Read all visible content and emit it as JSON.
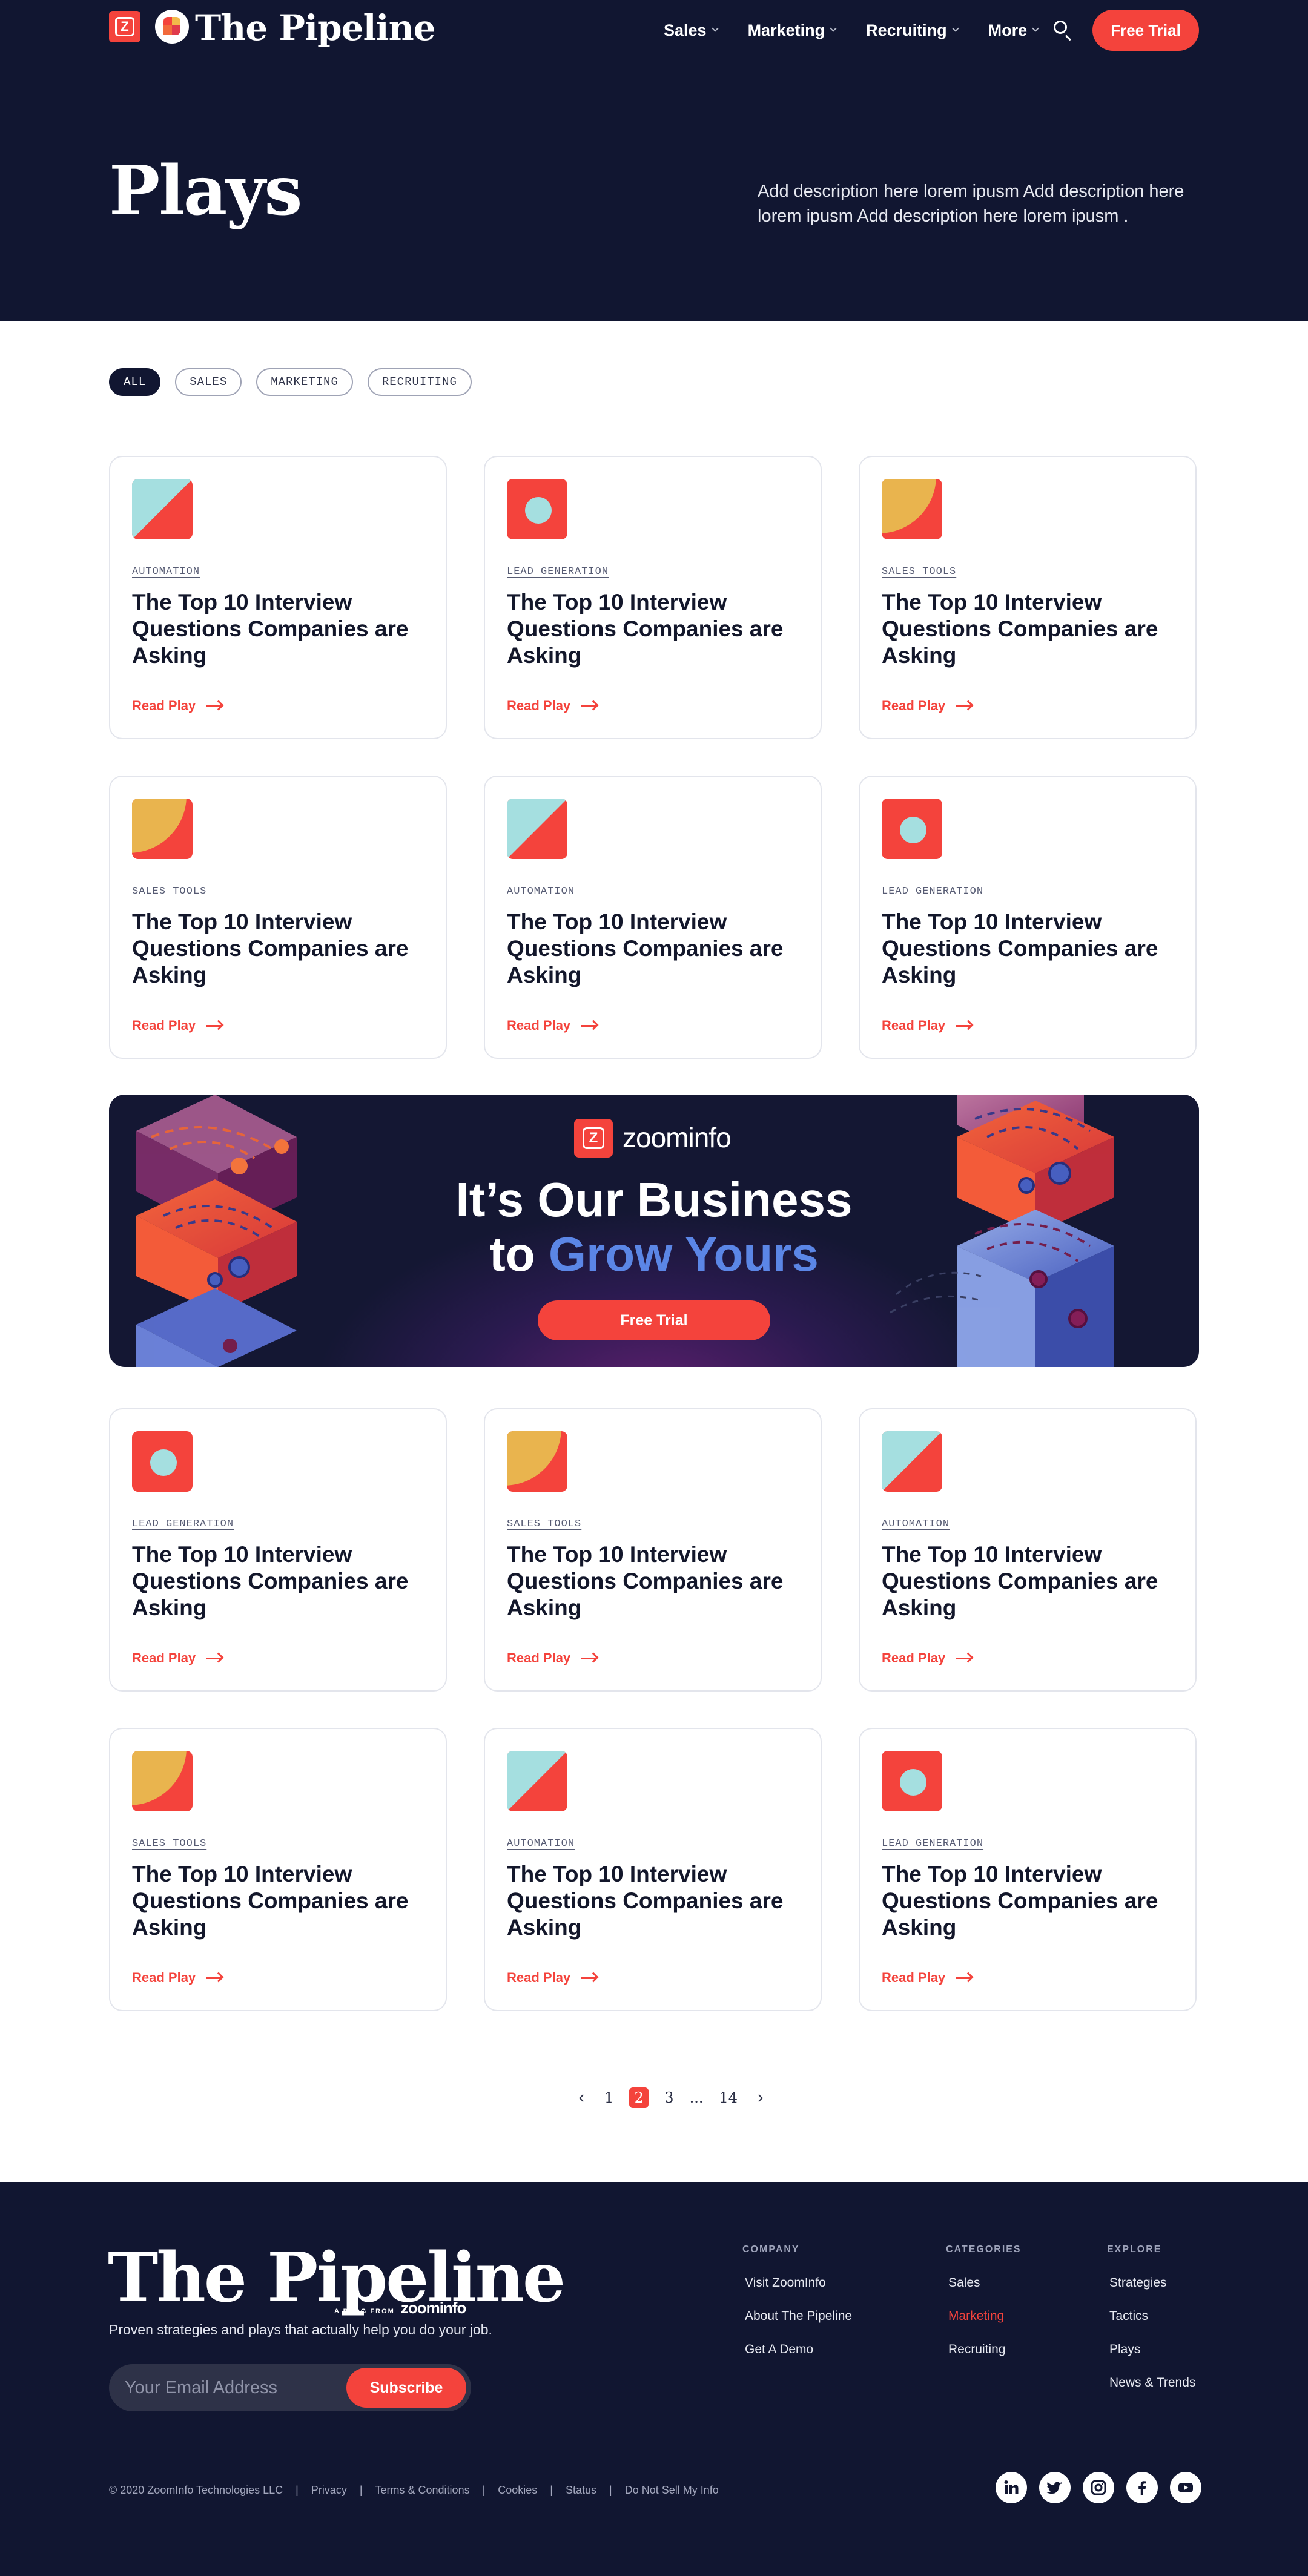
{
  "nav": {
    "brand": "The Pipeline",
    "items": [
      {
        "label": "Sales"
      },
      {
        "label": "Marketing"
      },
      {
        "label": "Recruiting"
      },
      {
        "label": "More"
      }
    ],
    "cta": "Free Trial"
  },
  "hero": {
    "title": "Plays",
    "description": "Add description here lorem ipusm  Add description here lorem ipusm Add description here lorem ipusm ."
  },
  "filters": [
    {
      "label": "ALL",
      "active": true
    },
    {
      "label": "SALES",
      "active": false
    },
    {
      "label": "MARKETING",
      "active": false
    },
    {
      "label": "RECRUITING",
      "active": false
    }
  ],
  "cards": [
    {
      "tag": "AUTOMATION",
      "title": "The Top 10 Interview Questions Companies are Asking",
      "link": "Read Play",
      "thumb": "diagonal"
    },
    {
      "tag": "LEAD GENERATION",
      "title": "The Top 10 Interview Questions Companies are Asking",
      "link": "Read Play",
      "thumb": "circle"
    },
    {
      "tag": "SALES TOOLS",
      "title": "The Top 10 Interview Questions Companies are Asking",
      "link": "Read Play",
      "thumb": "quarter"
    },
    {
      "tag": "SALES TOOLS",
      "title": "The Top 10 Interview Questions Companies are Asking",
      "link": "Read Play",
      "thumb": "quarter"
    },
    {
      "tag": "AUTOMATION",
      "title": "The Top 10 Interview Questions Companies are Asking",
      "link": "Read Play",
      "thumb": "diagonal"
    },
    {
      "tag": "LEAD GENERATION",
      "title": "The Top 10 Interview Questions Companies are Asking",
      "link": "Read Play",
      "thumb": "circle"
    },
    {
      "tag": "LEAD GENERATION",
      "title": "The Top 10 Interview Questions Companies are Asking",
      "link": "Read Play",
      "thumb": "circle"
    },
    {
      "tag": "SALES TOOLS",
      "title": "The Top 10 Interview Questions Companies are Asking",
      "link": "Read Play",
      "thumb": "quarter"
    },
    {
      "tag": "AUTOMATION",
      "title": "The Top 10 Interview Questions Companies are Asking",
      "link": "Read Play",
      "thumb": "diagonal"
    },
    {
      "tag": "SALES TOOLS",
      "title": "The Top 10 Interview Questions Companies are Asking",
      "link": "Read Play",
      "thumb": "quarter"
    },
    {
      "tag": "AUTOMATION",
      "title": "The Top 10 Interview Questions Companies are Asking",
      "link": "Read Play",
      "thumb": "diagonal"
    },
    {
      "tag": "LEAD GENERATION",
      "title": "The Top 10 Interview Questions Companies are Asking",
      "link": "Read Play",
      "thumb": "circle"
    }
  ],
  "banner": {
    "logo_word": "zoominfo",
    "line1": "It’s Our Business",
    "line2_prefix": "to ",
    "line2_highlight": "Grow Yours",
    "cta": "Free Trial"
  },
  "pagination": {
    "pages": [
      "1",
      "2",
      "3",
      "...",
      "14"
    ],
    "current": "2"
  },
  "footer": {
    "brand": "The Pipeline",
    "sub_small": "A BLOG FROM",
    "sub_brand": "zoominfo",
    "tagline": "Proven strategies and plays that actually help you do your job.",
    "email_placeholder": "Your Email Address",
    "subscribe": "Subscribe",
    "columns": [
      {
        "heading": "COMPANY",
        "links": [
          "Visit ZoomInfo",
          "About The Pipeline",
          "Get A Demo"
        ]
      },
      {
        "heading": "CATEGORIES",
        "links": [
          "Sales",
          "Marketing",
          "Recruiting"
        ],
        "active": "Marketing"
      },
      {
        "heading": "EXPLORE",
        "links": [
          "Strategies",
          "Tactics",
          "Plays",
          "News & Trends"
        ]
      }
    ],
    "legal": [
      "© 2020 ZoomInfo Technologies LLC",
      "Privacy",
      "Terms & Conditions",
      "Cookies",
      "Status",
      "Do Not Sell My Info"
    ],
    "social": [
      "linkedin-icon",
      "twitter-icon",
      "instagram-icon",
      "facebook-icon",
      "youtube-icon"
    ]
  },
  "colors": {
    "navy": "#111631",
    "accent": "#f4433c",
    "teal": "#a5dfe0",
    "mustard": "#e9b44e",
    "blue_highlight": "#5b86e6"
  }
}
